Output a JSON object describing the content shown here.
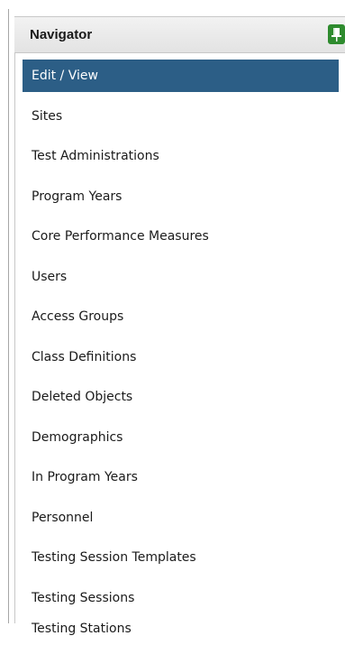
{
  "navigator": {
    "title": "Navigator",
    "pin_icon": "pin-icon",
    "accent_color": "#2e8b2e",
    "selected_color": "#2c5e86",
    "items": [
      {
        "label": "Edit / View",
        "selected": true
      },
      {
        "label": "Sites",
        "selected": false
      },
      {
        "label": "Test Administrations",
        "selected": false
      },
      {
        "label": "Program Years",
        "selected": false
      },
      {
        "label": "Core Performance Measures",
        "selected": false
      },
      {
        "label": "Users",
        "selected": false
      },
      {
        "label": "Access Groups",
        "selected": false
      },
      {
        "label": "Class Definitions",
        "selected": false
      },
      {
        "label": "Deleted Objects",
        "selected": false
      },
      {
        "label": "Demographics",
        "selected": false
      },
      {
        "label": "In Program Years",
        "selected": false
      },
      {
        "label": "Personnel",
        "selected": false
      },
      {
        "label": "Testing Session Templates",
        "selected": false
      },
      {
        "label": "Testing Sessions",
        "selected": false
      },
      {
        "label": "Testing Stations",
        "selected": false
      }
    ]
  }
}
